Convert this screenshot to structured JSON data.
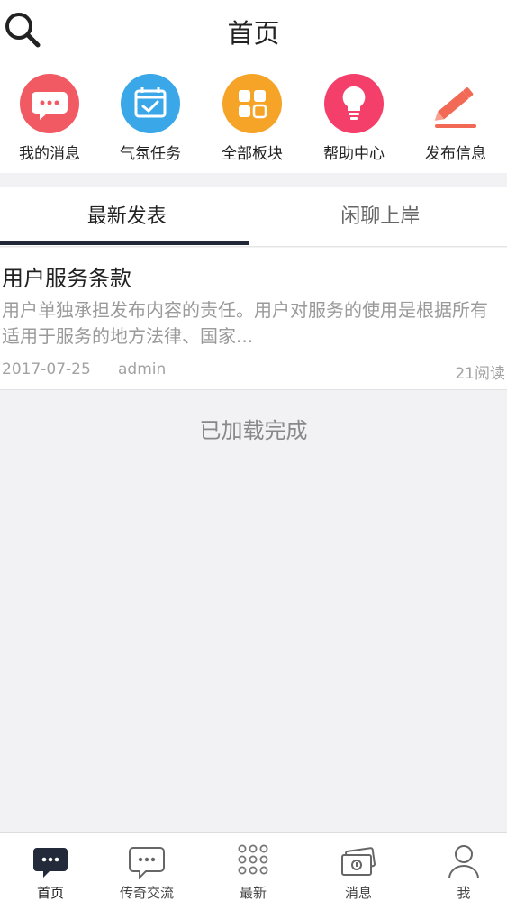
{
  "header": {
    "title": "首页"
  },
  "quick_links": [
    {
      "label": "我的消息",
      "icon": "chat-bubble-icon",
      "color": "#f25a63"
    },
    {
      "label": "气氛任务",
      "icon": "calendar-check-icon",
      "color": "#3aa7e8"
    },
    {
      "label": "全部板块",
      "icon": "grid-blocks-icon",
      "color": "#f6a428"
    },
    {
      "label": "帮助中心",
      "icon": "lightbulb-icon",
      "color": "#f43f6a"
    },
    {
      "label": "发布信息",
      "icon": "pencil-icon",
      "color": "#f26a55"
    }
  ],
  "tabs": [
    {
      "label": "最新发表",
      "active": true
    },
    {
      "label": "闲聊上岸",
      "active": false
    }
  ],
  "posts": [
    {
      "title": "用户服务条款",
      "excerpt": "用户单独承担发布内容的责任。用户对服务的使用是根据所有适用于服务的地方法律、国家...",
      "date": "2017-07-25",
      "author": "admin",
      "reads": "21阅读"
    }
  ],
  "status": {
    "loaded_text": "已加载完成"
  },
  "bottom_nav": [
    {
      "label": "首页",
      "icon": "home-chat-icon",
      "active": true
    },
    {
      "label": "传奇交流",
      "icon": "chat-outline-icon",
      "active": false
    },
    {
      "label": "最新",
      "icon": "dots-grid-icon",
      "active": false
    },
    {
      "label": "消息",
      "icon": "message-cards-icon",
      "active": false
    },
    {
      "label": "我",
      "icon": "person-icon",
      "active": false
    }
  ],
  "colors": {
    "tab_indicator": "#222838",
    "background": "#f2f2f4"
  }
}
